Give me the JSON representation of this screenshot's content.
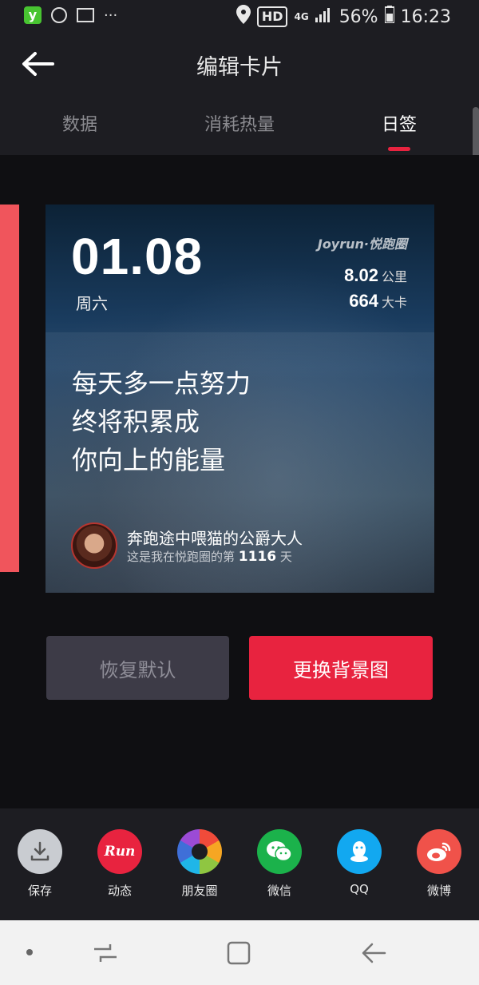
{
  "status_bar": {
    "network": "4G",
    "battery": "56%",
    "time": "16:23",
    "hd": "HD",
    "dots": "···"
  },
  "header": {
    "title": "编辑卡片"
  },
  "tabs": [
    {
      "label": "数据"
    },
    {
      "label": "消耗热量"
    },
    {
      "label": "日签",
      "active": true
    }
  ],
  "card": {
    "date": "01.08",
    "weekday": "周六",
    "brand": "Joyrun·悦跑圈",
    "distance_value": "8.02",
    "distance_unit": "公里",
    "calories_value": "664",
    "calories_unit": "大卡",
    "quote": [
      "每天多一点努力",
      "终将积累成",
      "你向上的能量"
    ],
    "username": "奔跑途中喂猫的公爵大人",
    "days_prefix": "这是我在悦跑圈的第",
    "days_count": "1116",
    "days_suffix": "天"
  },
  "buttons": {
    "reset": "恢复默认",
    "change_bg": "更换背景图"
  },
  "share": [
    {
      "label": "保存",
      "icon": "download-icon"
    },
    {
      "label": "动态",
      "icon": "run-logo-icon",
      "text": "Run"
    },
    {
      "label": "朋友圈",
      "icon": "moments-icon"
    },
    {
      "label": "微信",
      "icon": "wechat-icon"
    },
    {
      "label": "QQ",
      "icon": "qq-icon"
    },
    {
      "label": "微博",
      "icon": "weibo-icon"
    }
  ],
  "colors": {
    "accent": "#e8233f",
    "background": "#0f0f12",
    "bar": "#1d1d22"
  }
}
